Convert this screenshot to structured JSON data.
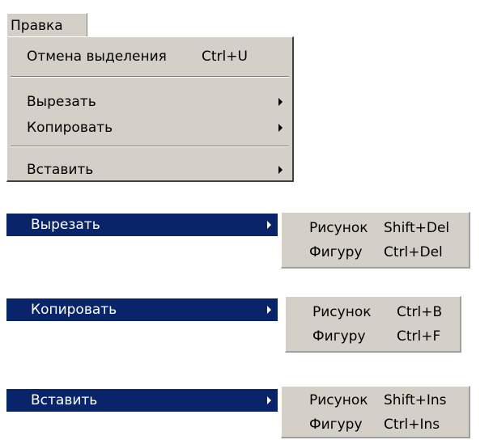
{
  "menu": {
    "title": "Правка",
    "items": [
      {
        "label": "Отмена выделения",
        "shortcut": "Ctrl+U"
      },
      {
        "label": "Вырезать"
      },
      {
        "label": "Копировать"
      },
      {
        "label": "Вставить"
      }
    ]
  },
  "submenus": [
    {
      "parent_label": "Вырезать",
      "items": [
        {
          "label": "Рисунок",
          "shortcut": "Shift+Del"
        },
        {
          "label": "Фигуру",
          "shortcut": "Ctrl+Del"
        }
      ]
    },
    {
      "parent_label": "Копировать",
      "items": [
        {
          "label": "Рисунок",
          "shortcut": "Ctrl+B"
        },
        {
          "label": "Фигуру",
          "shortcut": "Ctrl+F"
        }
      ]
    },
    {
      "parent_label": "Вставить",
      "items": [
        {
          "label": "Рисунок",
          "shortcut": "Shift+Ins"
        },
        {
          "label": "Фигуру",
          "shortcut": "Ctrl+Ins"
        }
      ]
    }
  ],
  "colors": {
    "menu_background": "#d4d0c8",
    "highlight": "#0a246a",
    "highlight_text": "#ffffff"
  },
  "icons": {
    "submenu_arrow": "submenu-arrow-icon"
  }
}
